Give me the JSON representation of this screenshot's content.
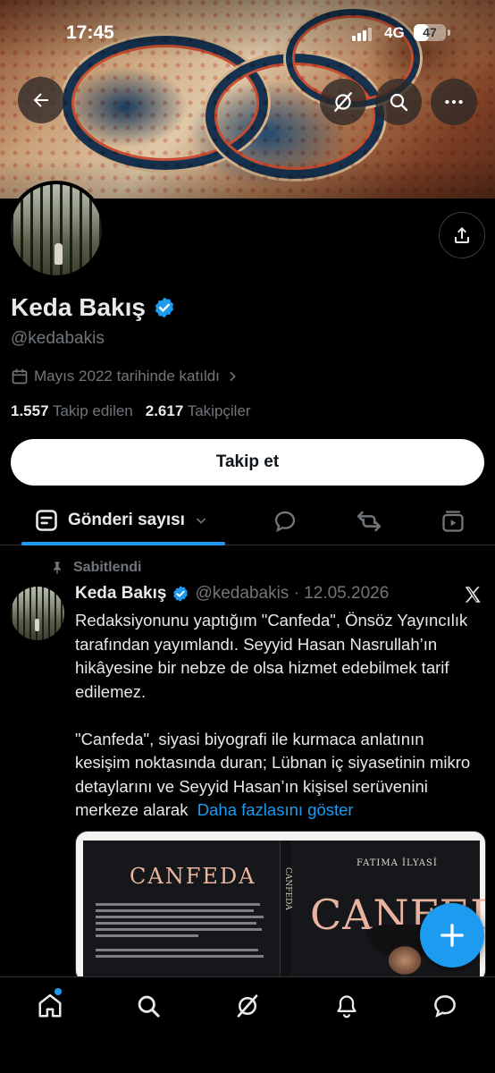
{
  "status_bar": {
    "time": "17:45",
    "network": "4G",
    "battery": "47",
    "battery_level": 0.47
  },
  "banner": {
    "icons": [
      "back-arrow-icon",
      "grok-icon",
      "search-icon",
      "more-icon"
    ]
  },
  "profile": {
    "name": "Keda Bakış",
    "handle": "@kedabakis",
    "verified": true,
    "joined": "Mayıs 2022 tarihinde katıldı",
    "following_count": "1.557",
    "following_label": "Takip edilen",
    "followers_count": "2.617",
    "followers_label": "Takipçiler",
    "follow_button": "Takip et"
  },
  "tabs": {
    "active_label": "Gönderi sayısı",
    "icons": [
      "replies-icon",
      "reposts-icon",
      "media-icon"
    ]
  },
  "post": {
    "pinned_label": "Sabitlendi",
    "author": "Keda Bakış",
    "handle_date": "@kedabakis · 12.05.2026",
    "paragraph1": "Redaksiyonunu yaptığım \"Canfeda\", Önsöz Yayıncılık tarafından yayımlandı. Seyyid Hasan Nasrullah’ın hikâyesine bir nebze de olsa hizmet edebilmek tarif edilemez.",
    "paragraph2": "\"Canfeda\", siyasi biyografi ile kurmaca anlatının kesişim noktasında duran; Lübnan iç siyasetinin mikro detaylarını ve Seyyid Hasan’ın kişisel serüvenini merkeze alarak",
    "show_more": "Daha fazlasını göster",
    "image": {
      "back_title": "CANFEDA",
      "spine": "CANFEDA",
      "author": "FATIMA İLYASİ",
      "front_title": "CANFEDA"
    }
  },
  "colors": {
    "accent": "#1d9bf0",
    "background": "#000000",
    "text": "#e7e9ea",
    "secondary_text": "#71767b"
  },
  "bottom_nav": [
    "home-icon",
    "search-icon",
    "grok-icon",
    "notifications-icon",
    "messages-icon"
  ]
}
